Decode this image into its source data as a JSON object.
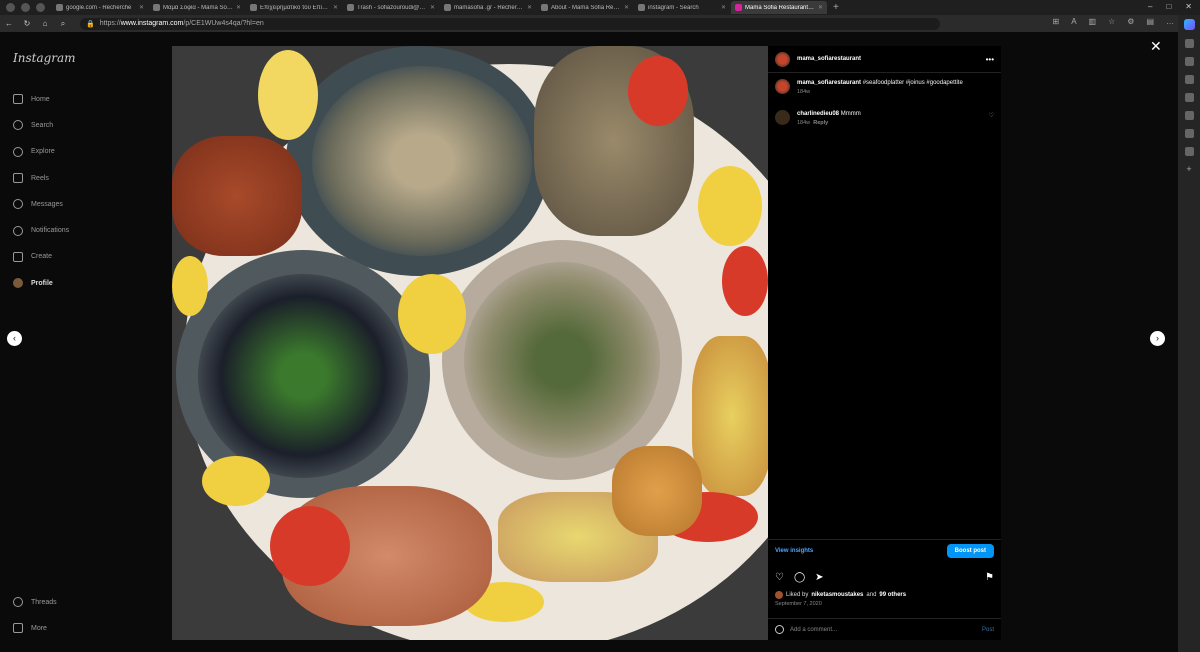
{
  "browser": {
    "tabs": [
      {
        "title": "google.com - Recherche",
        "active": false
      },
      {
        "title": "Μαμά Σοφία - Mama Sofia - Av...",
        "active": false
      },
      {
        "title": "Επιχειρηματικό του Επιχειρηματι...",
        "active": false
      },
      {
        "title": "Trash - sofiazouroudi@gmail.com",
        "active": false
      },
      {
        "title": "mamasofia .gr - Recherche",
        "active": false
      },
      {
        "title": "About - Mama Sofia Restaurant",
        "active": false
      },
      {
        "title": "instagram - Search",
        "active": false
      },
      {
        "title": "Mama Sofia Restaurant (@mam...",
        "active": true
      }
    ],
    "url_prefix": "https://",
    "url_host": "www.instagram.com",
    "url_path": "/p/CE1WUw4s4qa/?hl=en",
    "new_tab": "+"
  },
  "ig_sidebar": {
    "logo": "Instagram",
    "items": [
      {
        "label": "Home",
        "icon": "home-icon"
      },
      {
        "label": "Search",
        "icon": "search-icon"
      },
      {
        "label": "Explore",
        "icon": "explore-icon"
      },
      {
        "label": "Reels",
        "icon": "reels-icon"
      },
      {
        "label": "Messages",
        "icon": "messages-icon"
      },
      {
        "label": "Notifications",
        "icon": "heart-icon"
      },
      {
        "label": "Create",
        "icon": "plus-icon"
      },
      {
        "label": "Profile",
        "icon": "avatar-icon"
      }
    ],
    "bottom": [
      {
        "label": "Threads",
        "icon": "threads-icon"
      },
      {
        "label": "More",
        "icon": "menu-icon"
      }
    ]
  },
  "post": {
    "username": "mama_sofiarestaurant",
    "caption_user": "mama_sofiarestaurant",
    "caption_text": "#seafoodplatter #joinus #goodapettite",
    "caption_age": "184w",
    "comments": [
      {
        "user": "charlinedieu08",
        "text": "Mmmm",
        "age": "184w",
        "reply": "Reply"
      }
    ],
    "view_insights": "View insights",
    "boost": "Boost post",
    "liked_prefix": "Liked by",
    "liked_user": "niketasmoustakes",
    "liked_and": "and",
    "liked_others": "99 others",
    "date": "September 7, 2020",
    "add_comment_placeholder": "Add a comment...",
    "post_label": "Post"
  },
  "colors": {
    "accent": "#0095f6",
    "link": "#4aa8ff"
  }
}
